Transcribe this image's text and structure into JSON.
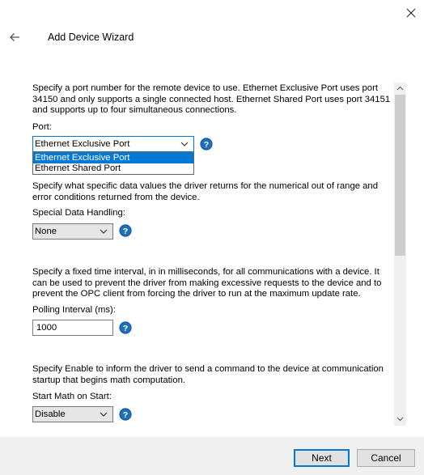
{
  "header": {
    "title": "Add Device Wizard",
    "close_icon": "close-icon",
    "back_icon": "back-arrow-icon"
  },
  "sections": {
    "port": {
      "description": "Specify a port number for the remote device to use. Ethernet Exclusive Port uses port 34150 and only supports a single connected host. Ethernet Shared Port uses port 34151 and supports up to four simultaneous connections.",
      "label": "Port:",
      "value": "Ethernet Exclusive Port",
      "options": [
        "Ethernet Exclusive Port",
        "Ethernet Shared Port"
      ],
      "highlighted_option": "Ethernet Exclusive Port"
    },
    "special_data": {
      "description": "Specify what specific data values the driver returns for the numerical out of range and error conditions returned from the device.",
      "label": "Special Data Handling:",
      "value": "None"
    },
    "polling": {
      "description": "Specify a fixed time interval, in in milliseconds, for all communications with a device. It can be used to prevent the driver from making excessive requests to the device and to prevent the OPC client from forcing the driver to run at the maximum update rate.",
      "label": "Polling Interval (ms):",
      "value": "1000"
    },
    "start_math": {
      "description": "Specify Enable to inform the driver to send a command to the device at communication startup that begins math computation.",
      "label": "Start Math on Start:",
      "value": "Disable"
    }
  },
  "footer": {
    "next_label": "Next",
    "cancel_label": "Cancel"
  },
  "colors": {
    "accent": "#0078d7",
    "help_icon_fill": "#1e6fb8",
    "footer_bg": "#f0f0f0"
  }
}
